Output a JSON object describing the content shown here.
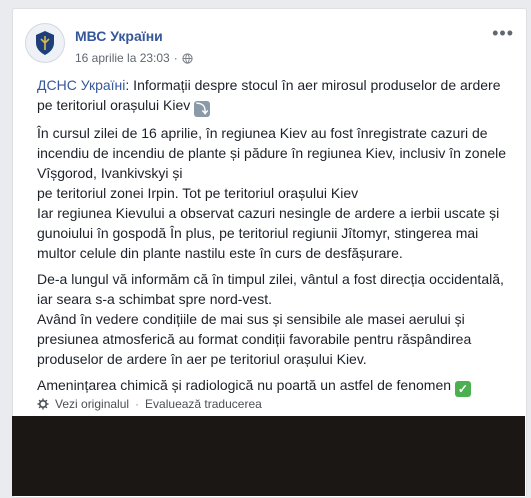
{
  "post": {
    "author": "МВС України",
    "timestamp": "16 aprilie la 23:03",
    "audience_icon": "globe-icon",
    "more_icon": "more-options-icon",
    "link_text": "ДСНС Україні",
    "title_text": ": Informații despre stocul în aer mirosul produselor de ardere pe teritoriul orașului Kiev",
    "paragraphs": [
      "În cursul zilei de 16 aprilie, în regiunea Kiev au fost înregistrate cazuri de incendiu de incendiu de plante și pădure în regiunea Kiev, inclusiv în zonele Vîșgorod, Ivankivskyi și",
      "pe teritoriul zonei Irpin. Tot pe teritoriul orașului Kiev",
      "Iar regiunea Kievului a observat cazuri nesingle de ardere a ierbii uscate și gunoiului în gospodă În plus, pe teritoriul regiunii Jîtomyr, stingerea mai multor celule din plante nastilu este în curs de desfășurare.",
      "De-a lungul vă informăm că în timpul zilei, vântul a fost direcția occidentală, iar seara s-a schimbat spre nord-vest.",
      "Având în vedere condițiile de mai sus și sensibile ale masei aerului și presiunea atmosferică au format condiții favorabile pentru răspândirea produselor de ardere în aer pe teritoriul orașului Kiev.",
      "Amenințarea chimică și radiologică nu poartă un astfel de fenomen"
    ]
  },
  "translation": {
    "see_original": "Vezi originalul",
    "separator": "·",
    "rate": "Evaluează traducerea"
  },
  "colors": {
    "link": "#365899",
    "background": "#e9ebee",
    "media": "#1a1715"
  }
}
